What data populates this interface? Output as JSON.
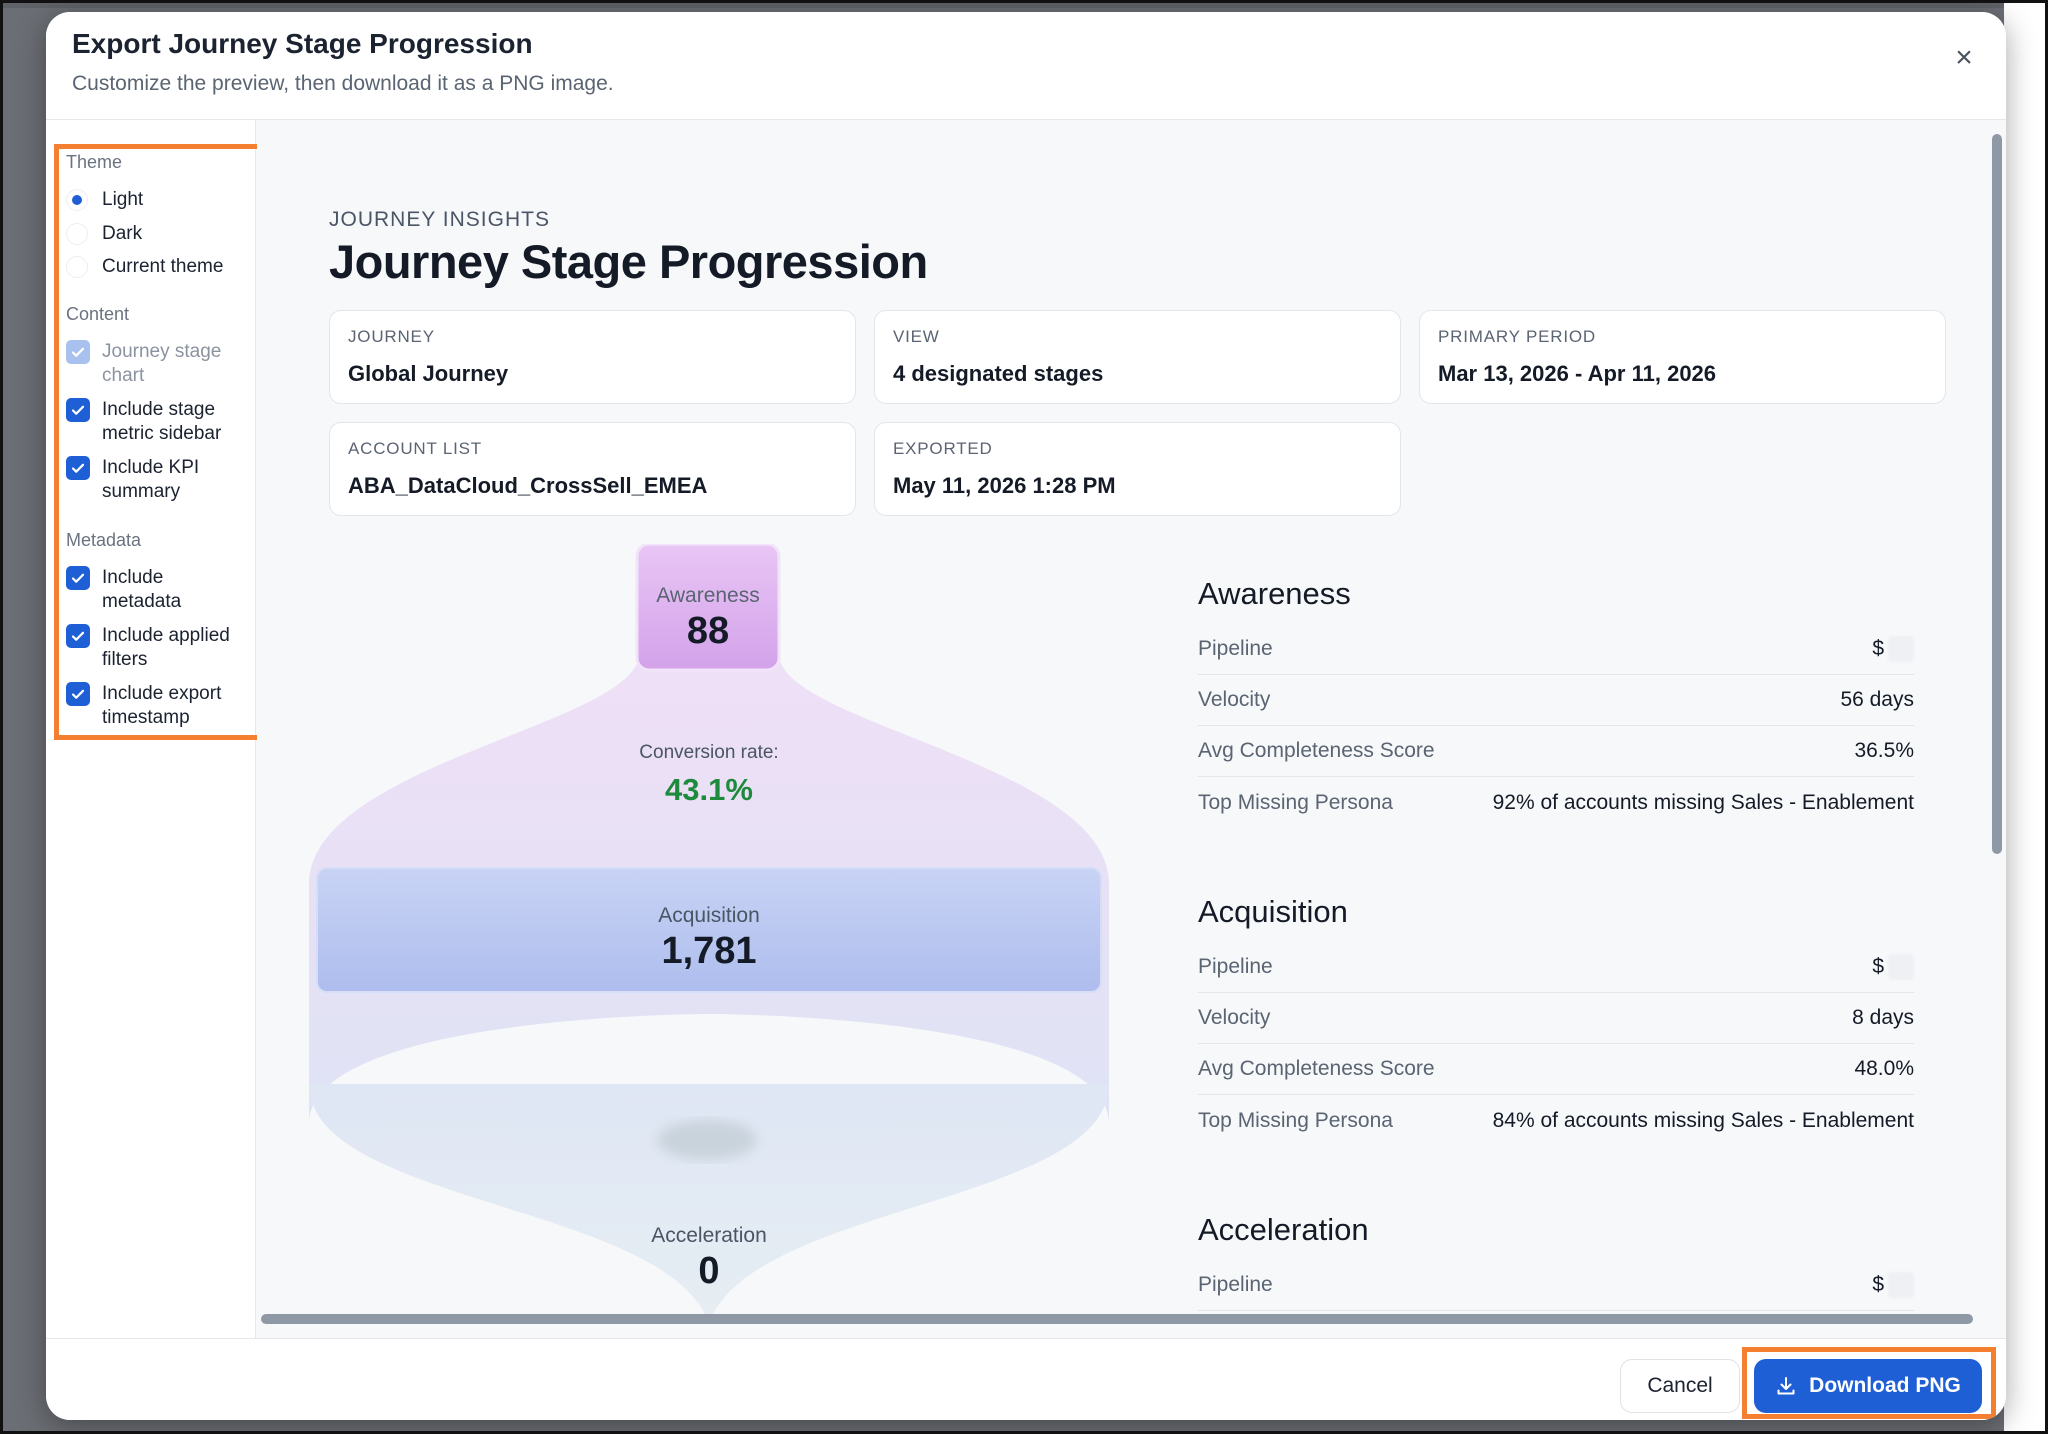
{
  "dialog": {
    "title": "Export Journey Stage Progression",
    "subtitle": "Customize the preview, then download it as a PNG image.",
    "close_glyph": "×"
  },
  "sidebar": {
    "theme_label": "Theme",
    "theme_options": [
      {
        "label": "Light",
        "selected": true
      },
      {
        "label": "Dark",
        "selected": false
      },
      {
        "label": "Current theme",
        "selected": false
      }
    ],
    "content_label": "Content",
    "content_options": [
      {
        "label": "Journey stage chart",
        "checked": true,
        "disabled": true
      },
      {
        "label": "Include stage metric sidebar",
        "checked": true,
        "disabled": false
      },
      {
        "label": "Include KPI summary",
        "checked": true,
        "disabled": false
      }
    ],
    "metadata_label": "Metadata",
    "metadata_options": [
      {
        "label": "Include metadata",
        "checked": true
      },
      {
        "label": "Include applied filters",
        "checked": true
      },
      {
        "label": "Include export timestamp",
        "checked": true
      }
    ]
  },
  "preview": {
    "eyebrow": "JOURNEY INSIGHTS",
    "title": "Journey Stage Progression",
    "meta": [
      {
        "key": "JOURNEY",
        "value": "Global Journey"
      },
      {
        "key": "VIEW",
        "value": "4 designated stages"
      },
      {
        "key": "PRIMARY PERIOD",
        "value": "Mar 13, 2026 - Apr 11, 2026"
      },
      {
        "key": "ACCOUNT LIST",
        "value": "ABA_DataCloud_CrossSell_EMEA"
      },
      {
        "key": "EXPORTED",
        "value": "May 11, 2026 1:28 PM"
      }
    ],
    "funnel": {
      "stages": [
        {
          "name": "Awareness",
          "value": "88"
        },
        {
          "name": "Acquisition",
          "value": "1,781"
        },
        {
          "name": "Acceleration",
          "value": "0"
        }
      ],
      "conversion_label": "Conversion rate:",
      "conversion_value": "43.1%"
    },
    "stage_metrics": [
      {
        "stage": "Awareness",
        "rows": [
          {
            "key": "Pipeline",
            "value": "$",
            "redacted": true
          },
          {
            "key": "Velocity",
            "value": "56 days"
          },
          {
            "key": "Avg Completeness Score",
            "value": "36.5%"
          },
          {
            "key": "Top Missing Persona",
            "value": "92% of accounts missing Sales - Enablement"
          }
        ]
      },
      {
        "stage": "Acquisition",
        "rows": [
          {
            "key": "Pipeline",
            "value": "$",
            "redacted": true
          },
          {
            "key": "Velocity",
            "value": "8 days"
          },
          {
            "key": "Avg Completeness Score",
            "value": "48.0%"
          },
          {
            "key": "Top Missing Persona",
            "value": "84% of accounts missing Sales - Enablement"
          }
        ]
      },
      {
        "stage": "Acceleration",
        "rows": [
          {
            "key": "Pipeline",
            "value": "$",
            "redacted": true
          }
        ]
      }
    ]
  },
  "footer": {
    "cancel_label": "Cancel",
    "download_label": "Download PNG"
  },
  "colors": {
    "primary": "#1f5fd6",
    "highlight": "#f47f30",
    "conversion": "#1e8a3c",
    "awareness_fill": "#dfb3ef",
    "acquisition_fill": "#b9c8f0"
  }
}
